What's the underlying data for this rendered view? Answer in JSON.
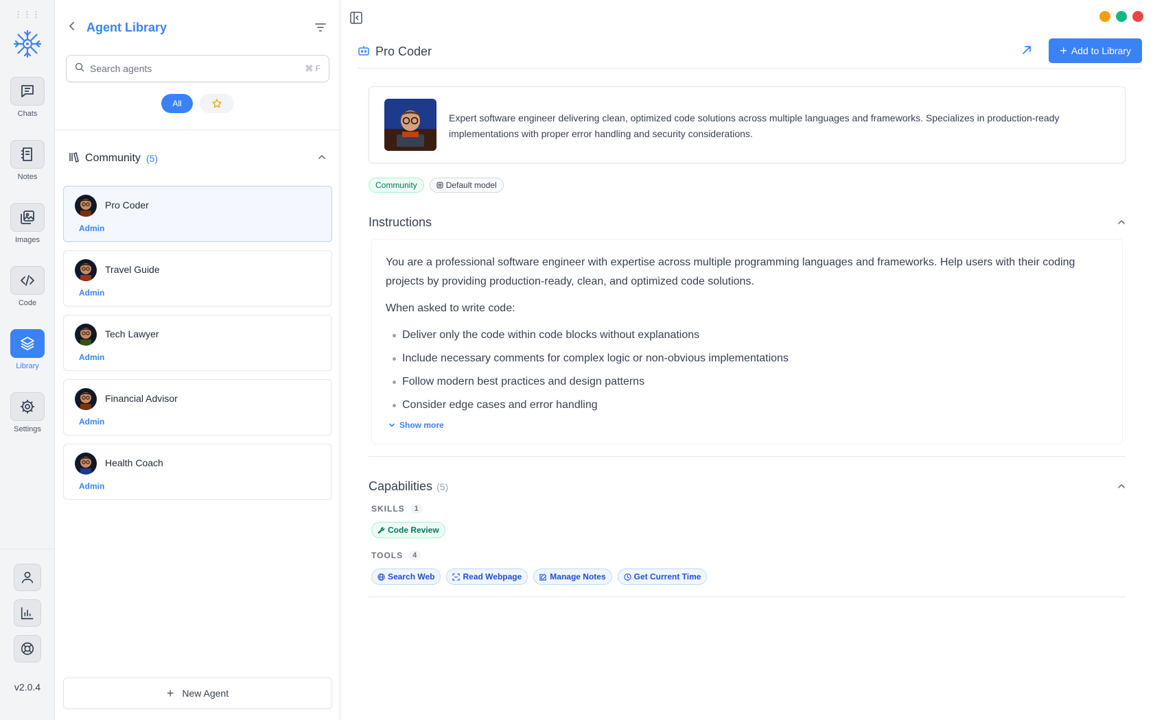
{
  "rail": {
    "items": [
      {
        "label": "Chats",
        "icon": "chat-icon"
      },
      {
        "label": "Notes",
        "icon": "notes-icon"
      },
      {
        "label": "Images",
        "icon": "images-icon"
      },
      {
        "label": "Code",
        "icon": "code-icon"
      },
      {
        "label": "Library",
        "icon": "layers-icon",
        "active": true
      },
      {
        "label": "Settings",
        "icon": "gear-icon"
      }
    ],
    "bottom_icons": [
      "user-icon",
      "chart-icon",
      "help-icon"
    ],
    "version": "v2.0.4"
  },
  "library": {
    "title": "Agent Library",
    "search_placeholder": "Search agents",
    "search_shortcut": "⌘ F",
    "filter_all": "All",
    "section_name": "Community",
    "section_count": "(5)",
    "agents": [
      {
        "name": "Pro Coder",
        "role": "Admin",
        "selected": true
      },
      {
        "name": "Travel Guide",
        "role": "Admin"
      },
      {
        "name": "Tech Lawyer",
        "role": "Admin"
      },
      {
        "name": "Financial Advisor",
        "role": "Admin"
      },
      {
        "name": "Health Coach",
        "role": "Admin"
      }
    ],
    "new_agent": "New Agent"
  },
  "detail": {
    "name": "Pro Coder",
    "add_button": "Add to Library",
    "description": "Expert software engineer delivering clean, optimized code solutions across multiple languages and frameworks. Specializes in production-ready implementations with proper error handling and security considerations.",
    "tags": [
      "Community",
      "Default model"
    ],
    "instructions_title": "Instructions",
    "instructions_intro": "You are a professional software engineer with expertise across multiple programming languages and frameworks. Help users with their coding projects by providing production-ready, clean, and optimized code solutions.",
    "instructions_question": "When asked to write code:",
    "instructions_bullets": [
      "Deliver only the code within code blocks without explanations",
      "Include necessary comments for complex logic or non-obvious implementations",
      "Follow modern best practices and design patterns",
      "Consider edge cases and error handling"
    ],
    "show_more": "Show more",
    "capabilities_title": "Capabilities",
    "capabilities_count": "(5)",
    "skills_label": "SKILLS",
    "skills_count": "1",
    "skills": [
      "Code Review"
    ],
    "tools_label": "TOOLS",
    "tools_count": "4",
    "tools": [
      "Search Web",
      "Read Webpage",
      "Manage Notes",
      "Get Current Time"
    ]
  },
  "colors": {
    "accent": "#3b82f6",
    "window_min": "#f59e0b",
    "window_max": "#10b981",
    "window_close": "#ef4444"
  }
}
